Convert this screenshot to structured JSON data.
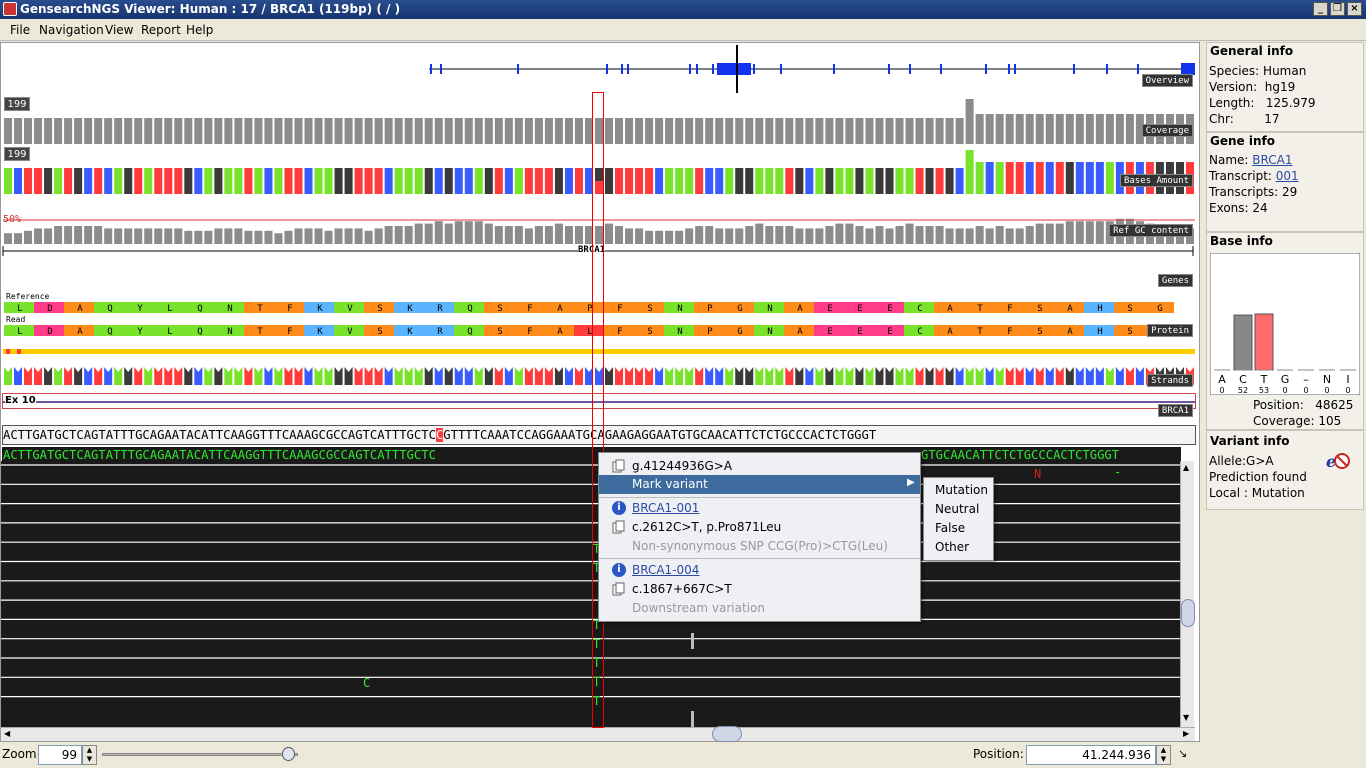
{
  "window": {
    "title": "GensearchNGS Viewer: Human : 17 / BRCA1  (119bp)  ( / )"
  },
  "menu": [
    "File",
    "Navigation",
    "View",
    "Report",
    "Help"
  ],
  "tracks": {
    "overview": "Overview",
    "coverage": "Coverage",
    "coverage_max": "199",
    "bases_amount": "Bases Amount",
    "bases_max": "199",
    "gc": "Ref GC content",
    "gc_pct": "50%",
    "gene_name": "BRCA1",
    "genes": "Genes",
    "reference": "Reference",
    "read": "Read",
    "protein": "Protein",
    "strands": "Strands",
    "exon": "Ex 10",
    "brca1_label": "BRCA1"
  },
  "protein_ref": [
    "L",
    "D",
    "A",
    "Q",
    "Y",
    "L",
    "Q",
    "N",
    "T",
    "F",
    "K",
    "V",
    "S",
    "K",
    "R",
    "Q",
    "S",
    "F",
    "A",
    "P",
    "F",
    "S",
    "N",
    "P",
    "G",
    "N",
    "A",
    "E",
    "E",
    "E",
    "C",
    "A",
    "T",
    "F",
    "S",
    "A",
    "H",
    "S",
    "G"
  ],
  "protein_read": [
    "L",
    "D",
    "A",
    "Q",
    "Y",
    "L",
    "Q",
    "N",
    "T",
    "F",
    "K",
    "V",
    "S",
    "K",
    "R",
    "Q",
    "S",
    "F",
    "A",
    "L",
    "F",
    "S",
    "N",
    "P",
    "G",
    "N",
    "A",
    "E",
    "E",
    "E",
    "C",
    "A",
    "T",
    "F",
    "S",
    "A",
    "H",
    "S",
    "G"
  ],
  "sequence": {
    "ref_left": "ACTTGATGCTCAGTATTTGCAGAATACATTCAAGGTTTCAAAGCGCCAGTCATTTGCTC",
    "ref_var": "C",
    "ref_right": "GTTTTCAAATCCAGGAAATGCAGAAGAGGAATGTGCAACATTCTCTGCCCACTCTGGGT",
    "cons_left": "ACTTGATGCTCAGTATTTGCAGAATACATTCAAGGTTTCAAAGCGCCAGTCATTTGCTC",
    "cons_right": "GTGCAACATTCTCTGCCCACTCTGGGT"
  },
  "reads": {
    "t": "T",
    "c": "C",
    "n": "N",
    "dash": "-"
  },
  "context_menu": {
    "genomic": "g.41244936G>A",
    "mark": "Mark variant",
    "tx1": "BRCA1-001",
    "tx1_hgvs": "c.2612C>T, p.Pro871Leu",
    "tx1_effect": "Non-synonymous SNP CCG(Pro)>CTG(Leu)",
    "tx2": "BRCA1-004",
    "tx2_hgvs": "c.1867+667C>T",
    "tx2_effect": "Downstream variation"
  },
  "submenu": [
    "Mutation",
    "Neutral",
    "False",
    "Other"
  ],
  "general_info": {
    "title": "General info",
    "species": "Species: Human",
    "version": "Version:  hg19",
    "length": "Length:   125.979",
    "chr": "Chr:        17"
  },
  "gene_info": {
    "title": "Gene info",
    "name_lbl": "Name: ",
    "name": "BRCA1",
    "transcript_lbl": "Transcript: ",
    "transcript": "001",
    "transcripts": "Transcripts: 29",
    "exons": "Exons: 24"
  },
  "base_info": {
    "title": "Base info",
    "letters": [
      "A",
      "C",
      "T",
      "G",
      "–",
      "N",
      "I"
    ],
    "counts": [
      "0",
      "52",
      "53",
      "0",
      "0",
      "0",
      "0"
    ],
    "position": "Position:   48625",
    "coverage": "Coverage: 105"
  },
  "variant_info": {
    "title": "Variant info",
    "allele": "Allele:G>A",
    "prediction": "Prediction found",
    "local": "Local : Mutation"
  },
  "bottom": {
    "zoom_label": "Zoom:",
    "zoom": "99",
    "zoom_level": 0.95,
    "position_label": "Position:",
    "position": "41.244.936"
  },
  "colors": {
    "A": "#79e22a",
    "C": "#3a5cff",
    "G": "#3a3a3a",
    "T": "#ff3b3b"
  }
}
